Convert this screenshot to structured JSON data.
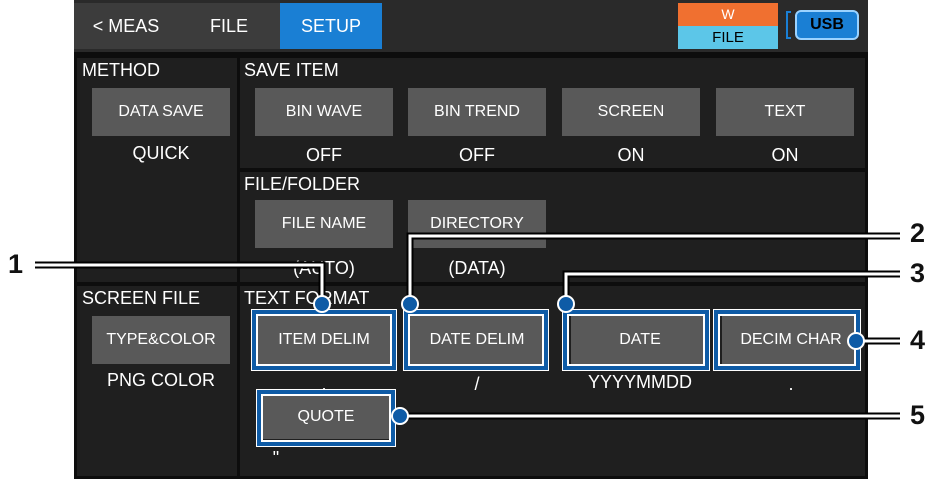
{
  "tabs": {
    "meas": "< MEAS",
    "file": "FILE",
    "setup": "SETUP"
  },
  "status": {
    "w": "W",
    "file": "FILE",
    "usb": "USB"
  },
  "method": {
    "title": "METHOD",
    "button": "DATA SAVE",
    "value": "QUICK"
  },
  "save_item": {
    "title": "SAVE ITEM",
    "items": [
      {
        "label": "BIN WAVE",
        "value": "OFF"
      },
      {
        "label": "BIN TREND",
        "value": "OFF"
      },
      {
        "label": "SCREEN",
        "value": "ON"
      },
      {
        "label": "TEXT",
        "value": "ON"
      }
    ]
  },
  "file_folder": {
    "title": "FILE/FOLDER",
    "items": [
      {
        "label": "FILE NAME",
        "value": "(AUTO)"
      },
      {
        "label": "DIRECTORY",
        "value": "(DATA)"
      }
    ]
  },
  "screen_file": {
    "title": "SCREEN FILE",
    "button": "TYPE&COLOR",
    "value": "PNG COLOR"
  },
  "text_format": {
    "title": "TEXT FORMAT",
    "items": [
      {
        "label": "ITEM DELIM",
        "value": ","
      },
      {
        "label": "DATE DELIM",
        "value": "/"
      },
      {
        "label": "DATE",
        "value": "YYYYMMDD"
      },
      {
        "label": "DECIM CHAR",
        "value": "."
      },
      {
        "label": "QUOTE",
        "value": "\""
      }
    ]
  },
  "callouts": [
    "1",
    "2",
    "3",
    "4",
    "5"
  ]
}
